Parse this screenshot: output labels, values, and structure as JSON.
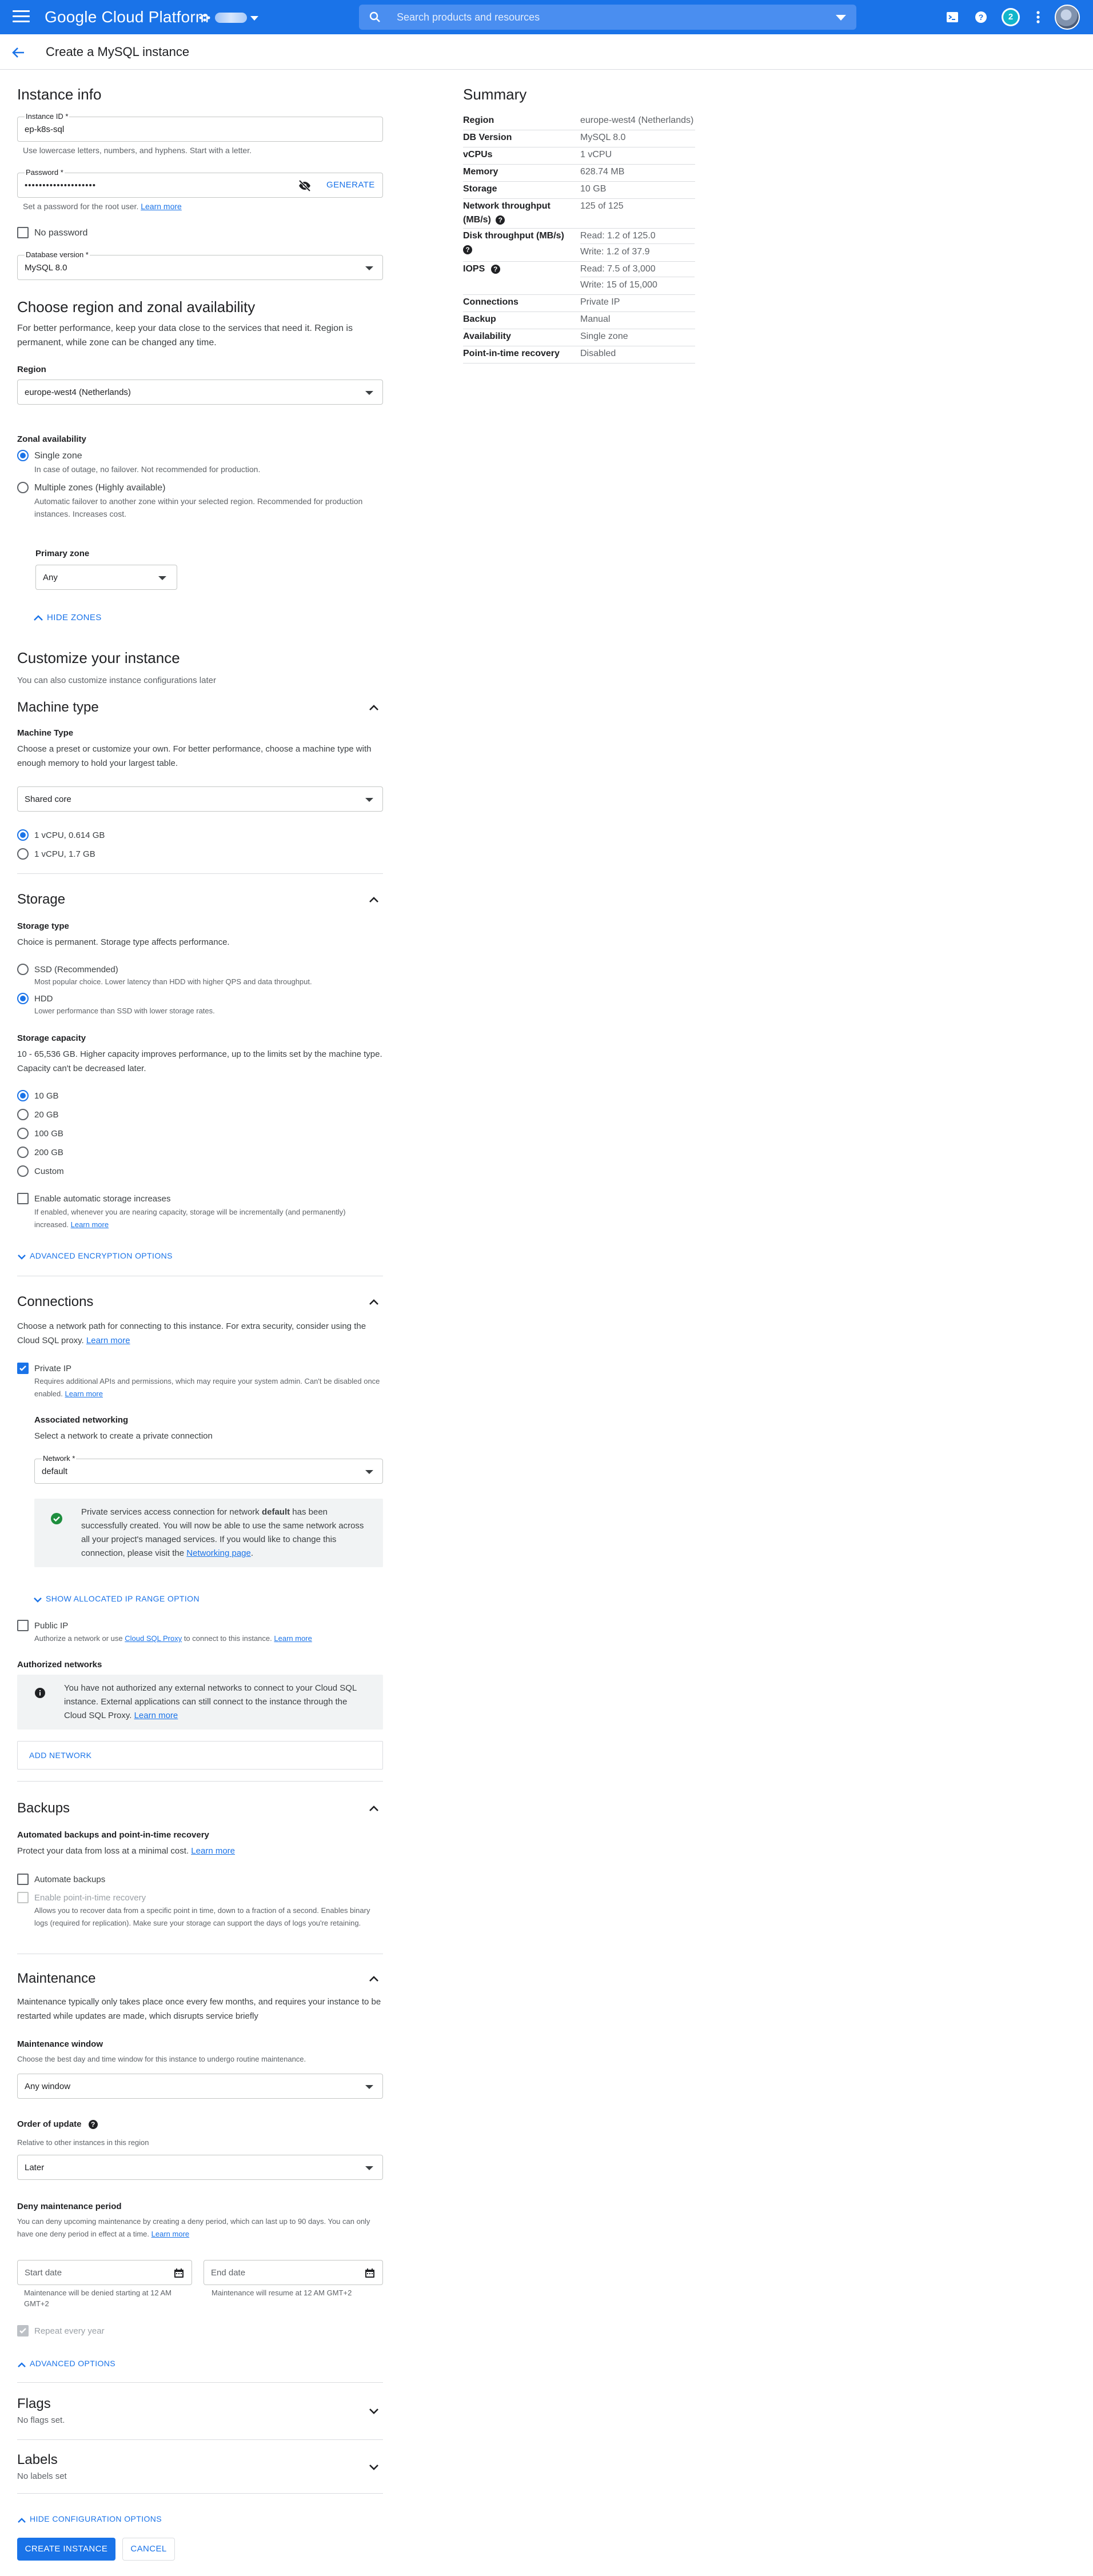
{
  "topbar": {
    "brand": "Google Cloud Platform",
    "search_placeholder": "Search products and resources",
    "notification_count": "2"
  },
  "subbar": {
    "title": "Create a MySQL instance"
  },
  "instance_info": {
    "heading": "Instance info",
    "id_label": "Instance ID *",
    "id_value": "ep-k8s-sql",
    "id_hint": "Use lowercase letters, numbers, and hyphens. Start with a letter.",
    "pw_label": "Password *",
    "pw_value": "••••••••••••••••••••",
    "generate": "GENERATE",
    "pw_hint": "Set a password for the root user.",
    "pw_hint_link": "Learn more",
    "no_password": "No password",
    "dbver_label": "Database version *",
    "dbver_value": "MySQL 8.0"
  },
  "region": {
    "heading": "Choose region and zonal availability",
    "desc": "For better performance, keep your data close to the services that need it. Region is permanent, while zone can be changed any time.",
    "region_label": "Region",
    "region_value": "europe-west4 (Netherlands)",
    "zonal_label": "Zonal availability",
    "single_zone": "Single zone",
    "single_zone_hint": "In case of outage, no failover. Not recommended for production.",
    "multi_zone": "Multiple zones (Highly available)",
    "multi_zone_hint": "Automatic failover to another zone within your selected region. Recommended for production instances. Increases cost.",
    "primary_zone_label": "Primary zone",
    "primary_zone_value": "Any",
    "hide_zones": "HIDE ZONES"
  },
  "customize": {
    "heading": "Customize your instance",
    "sub": "You can also customize instance configurations later"
  },
  "machine": {
    "heading": "Machine type",
    "label": "Machine Type",
    "desc": "Choose a preset or customize your own. For better performance, choose a machine type with enough memory to hold your largest table.",
    "select_value": "Shared core",
    "opt1": "1 vCPU, 0.614 GB",
    "opt2": "1 vCPU, 1.7 GB"
  },
  "storage": {
    "heading": "Storage",
    "type_label": "Storage type",
    "type_desc": "Choice is permanent. Storage type affects performance.",
    "ssd": "SSD (Recommended)",
    "ssd_hint": "Most popular choice. Lower latency than HDD with higher QPS and data throughput.",
    "hdd": "HDD",
    "hdd_hint": "Lower performance than SSD with lower storage rates.",
    "cap_label": "Storage capacity",
    "cap_desc": "10 - 65,536 GB. Higher capacity improves performance, up to the limits set by the machine type. Capacity can't be decreased later.",
    "caps": [
      "10 GB",
      "20 GB",
      "100 GB",
      "200 GB",
      "Custom"
    ],
    "auto": "Enable automatic storage increases",
    "auto_hint": "If enabled, whenever you are nearing capacity, storage will be incrementally (and permanently) increased.",
    "auto_link": "Learn more",
    "adv_enc": "ADVANCED ENCRYPTION OPTIONS"
  },
  "connections": {
    "heading": "Connections",
    "desc": "Choose a network path for connecting to this instance. For extra security, consider using the Cloud SQL proxy.",
    "desc_link": "Learn more",
    "private_ip": "Private IP",
    "private_hint": "Requires additional APIs and permissions, which may require your system admin. Can't be disabled once enabled.",
    "private_link": "Learn more",
    "assoc_label": "Associated networking",
    "assoc_desc": "Select a network to create a private connection",
    "network_label": "Network *",
    "network_value": "default",
    "success_pre": "Private services access connection for network ",
    "success_net": "default",
    "success_post": " has been successfully created. You will now be able to use the same network across all your project's managed services. If you would like to change this connection, please visit the ",
    "success_link": "Networking page",
    "success_end": ".",
    "show_alloc": "SHOW ALLOCATED IP RANGE OPTION",
    "public_ip": "Public IP",
    "public_hint_pre": "Authorize a network or use ",
    "public_hint_link1": "Cloud SQL Proxy",
    "public_hint_mid": " to connect to this instance.",
    "public_hint_link2": "Learn more",
    "auth_label": "Authorized networks",
    "auth_info": "You have not authorized any external networks to connect to your Cloud SQL instance. External applications can still connect to the instance through the Cloud SQL Proxy.",
    "auth_link": "Learn more",
    "add_network": "ADD NETWORK"
  },
  "backups": {
    "heading": "Backups",
    "label": "Automated backups and point-in-time recovery",
    "desc": "Protect your data from loss at a minimal cost.",
    "desc_link": "Learn more",
    "auto": "Automate backups",
    "pitr": "Enable point-in-time recovery",
    "pitr_hint": "Allows you to recover data from a specific point in time, down to a fraction of a second. Enables binary logs (required for replication). Make sure your storage can support the days of logs you're retaining."
  },
  "maintenance": {
    "heading": "Maintenance",
    "desc": "Maintenance typically only takes place once every few months, and requires your instance to be restarted while updates are made, which disrupts service briefly",
    "window_label": "Maintenance window",
    "window_desc": "Choose the best day and time window for this instance to undergo routine maintenance.",
    "window_value": "Any window",
    "order_label": "Order of update",
    "order_desc": "Relative to other instances in this region",
    "order_value": "Later",
    "deny_label": "Deny maintenance period",
    "deny_desc": "You can deny upcoming maintenance by creating a deny period, which can last up to 90 days. You can only have one deny period in effect at a time.",
    "deny_link": "Learn more",
    "start_ph": "Start date",
    "end_ph": "End date",
    "start_hint": "Maintenance will be denied starting at 12 AM GMT+2",
    "end_hint": "Maintenance will resume at 12 AM GMT+2",
    "repeat": "Repeat every year",
    "adv": "ADVANCED OPTIONS"
  },
  "flags": {
    "heading": "Flags",
    "sub": "No flags set."
  },
  "labels": {
    "heading": "Labels",
    "sub": "No labels set"
  },
  "footer": {
    "hide_config": "HIDE CONFIGURATION OPTIONS",
    "create": "CREATE INSTANCE",
    "cancel": "CANCEL"
  },
  "summary": {
    "heading": "Summary",
    "rows": [
      {
        "k": "Region",
        "v": "europe-west4 (Netherlands)"
      },
      {
        "k": "DB Version",
        "v": "MySQL 8.0"
      },
      {
        "k": "vCPUs",
        "v": "1 vCPU"
      },
      {
        "k": "Memory",
        "v": "628.74 MB"
      },
      {
        "k": "Storage",
        "v": "10 GB"
      },
      {
        "k": "Network throughput",
        "k2": "(MB/s)",
        "v": "125 of 125"
      },
      {
        "k": "Disk throughput (MB/s)",
        "v": "Read: 1.2 of 125.0",
        "v2": "Write: 1.2 of 37.9"
      },
      {
        "k": "IOPS",
        "v": "Read: 7.5 of 3,000",
        "v2": "Write: 15 of 15,000"
      },
      {
        "k": "Connections",
        "v": "Private IP"
      },
      {
        "k": "Backup",
        "v": "Manual"
      },
      {
        "k": "Availability",
        "v": "Single zone"
      },
      {
        "k": "Point-in-time recovery",
        "v": "Disabled"
      }
    ]
  },
  "colors": {
    "accent": "#1a73e8",
    "success": "#1e8e3e"
  }
}
